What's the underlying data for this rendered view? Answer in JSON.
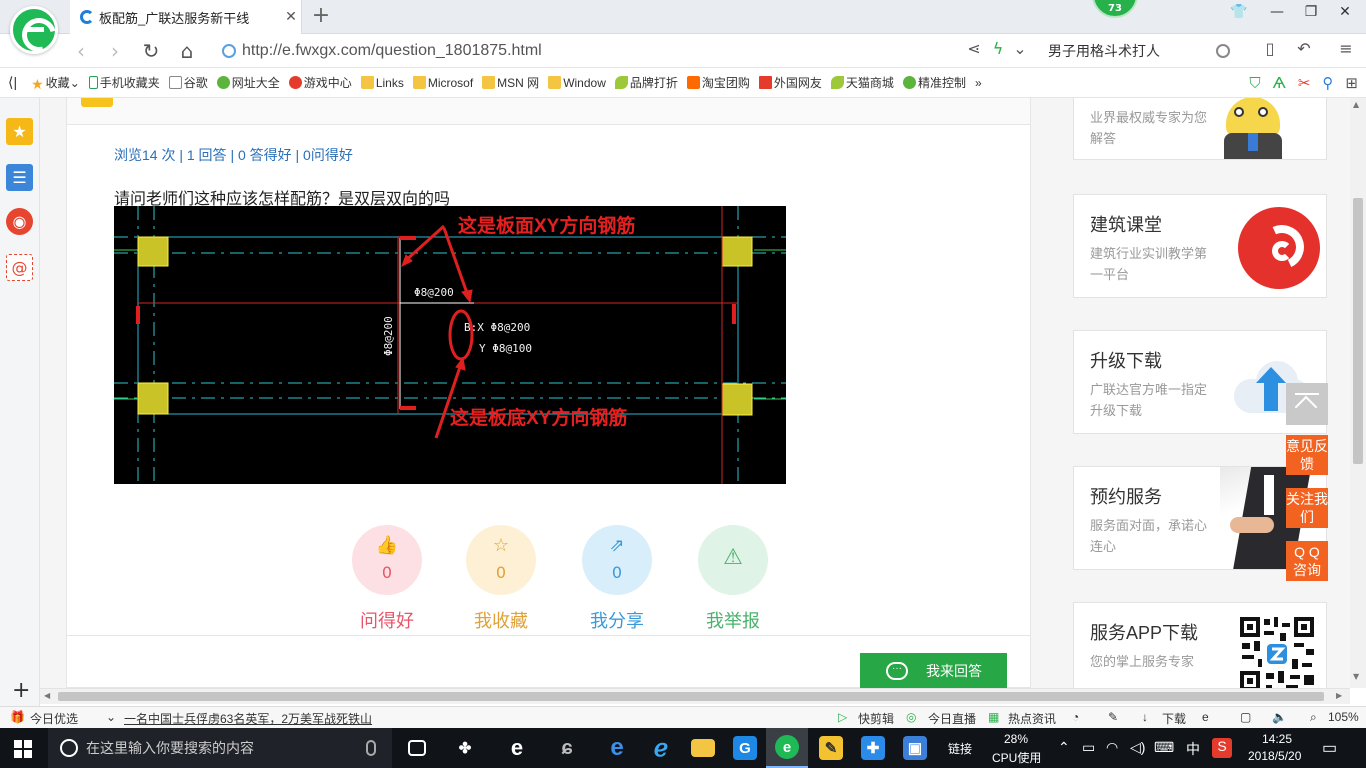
{
  "browser": {
    "tab_title": "板配筋_广联达服务新干线",
    "new_tab": "+",
    "badge_count": "73",
    "url": "http://e.fwxgx.com/question_1801875.html",
    "search_text": "男子用格斗术打人"
  },
  "favorites": [
    {
      "icon": "star-icon",
      "label": "收藏"
    },
    {
      "icon": "phone-icon",
      "label": "手机收藏夹"
    },
    {
      "icon": "doc-icon",
      "label": "谷歌"
    },
    {
      "icon": "green-globe-icon",
      "label": "网址大全"
    },
    {
      "icon": "game-icon",
      "label": "游戏中心"
    },
    {
      "icon": "folder-icon",
      "label": "Links"
    },
    {
      "icon": "folder-icon",
      "label": "Microsof"
    },
    {
      "icon": "folder-icon",
      "label": "MSN 网"
    },
    {
      "icon": "folder-icon",
      "label": "Window"
    },
    {
      "icon": "leaf-icon",
      "label": "品牌打折"
    },
    {
      "icon": "taobao-icon",
      "label": "淘宝团购"
    },
    {
      "icon": "red-flag-icon",
      "label": "外国网友"
    },
    {
      "icon": "leaf-icon",
      "label": "天猫商城"
    },
    {
      "icon": "wechat-icon",
      "label": "精准控制"
    }
  ],
  "question": {
    "stats": "浏览14 次 | 1 回答 | 0 答得好 | 0问得好",
    "text": "请问老师们这种应该怎样配筋？是双层双向的吗",
    "cad_annotations": {
      "top_note": "这是板面XY方向钢筋",
      "bottom_note": "这是板底XY方向钢筋",
      "top_bar": "Φ8@200",
      "side_bar": "Φ8@200",
      "bx": "B:X Φ8@200",
      "by": "Y Φ8@100"
    }
  },
  "actions": [
    {
      "label": "问得好",
      "count": "0",
      "color": "#e8546a",
      "bg": "#fde0e4",
      "icon": "thumbs-up-icon"
    },
    {
      "label": "我收藏",
      "count": "0",
      "color": "#e0a238",
      "bg": "#fdf0d5",
      "icon": "star-icon"
    },
    {
      "label": "我分享",
      "count": "0",
      "color": "#3a9ad9",
      "bg": "#d9eefb",
      "icon": "share-icon"
    },
    {
      "label": "我举报",
      "count": "0",
      "color": "#49b26b",
      "bg": "#dff3e6",
      "icon": "warning-icon"
    }
  ],
  "answer_button": "我来回答",
  "right_cards": [
    {
      "title": "",
      "desc": "业界最权威专家为您解答"
    },
    {
      "title": "建筑课堂",
      "desc": "建筑行业实训教学第一平台"
    },
    {
      "title": "升级下载",
      "desc": "广联达官方唯一指定升级下载"
    },
    {
      "title": "预约服务",
      "desc": "服务面对面，承诺心连心"
    },
    {
      "title": "服务APP下载",
      "desc": "您的掌上服务专家"
    }
  ],
  "float_buttons": [
    "意见反馈",
    "关注我们",
    "Q Q 咨询"
  ],
  "statusbar": {
    "today": "今日优选",
    "news": "一名中国士兵俘虏63名英军，2万美军战死铁山",
    "items": [
      "快剪辑",
      "今日直播",
      "热点资讯",
      "下载",
      "105%"
    ]
  },
  "taskbar": {
    "search_placeholder": "在这里输入你要搜索的内容",
    "link": "链接",
    "cpu_percent": "28%",
    "cpu_label": "CPU使用",
    "ime": "中",
    "time": "14:25",
    "date": "2018/5/20"
  }
}
